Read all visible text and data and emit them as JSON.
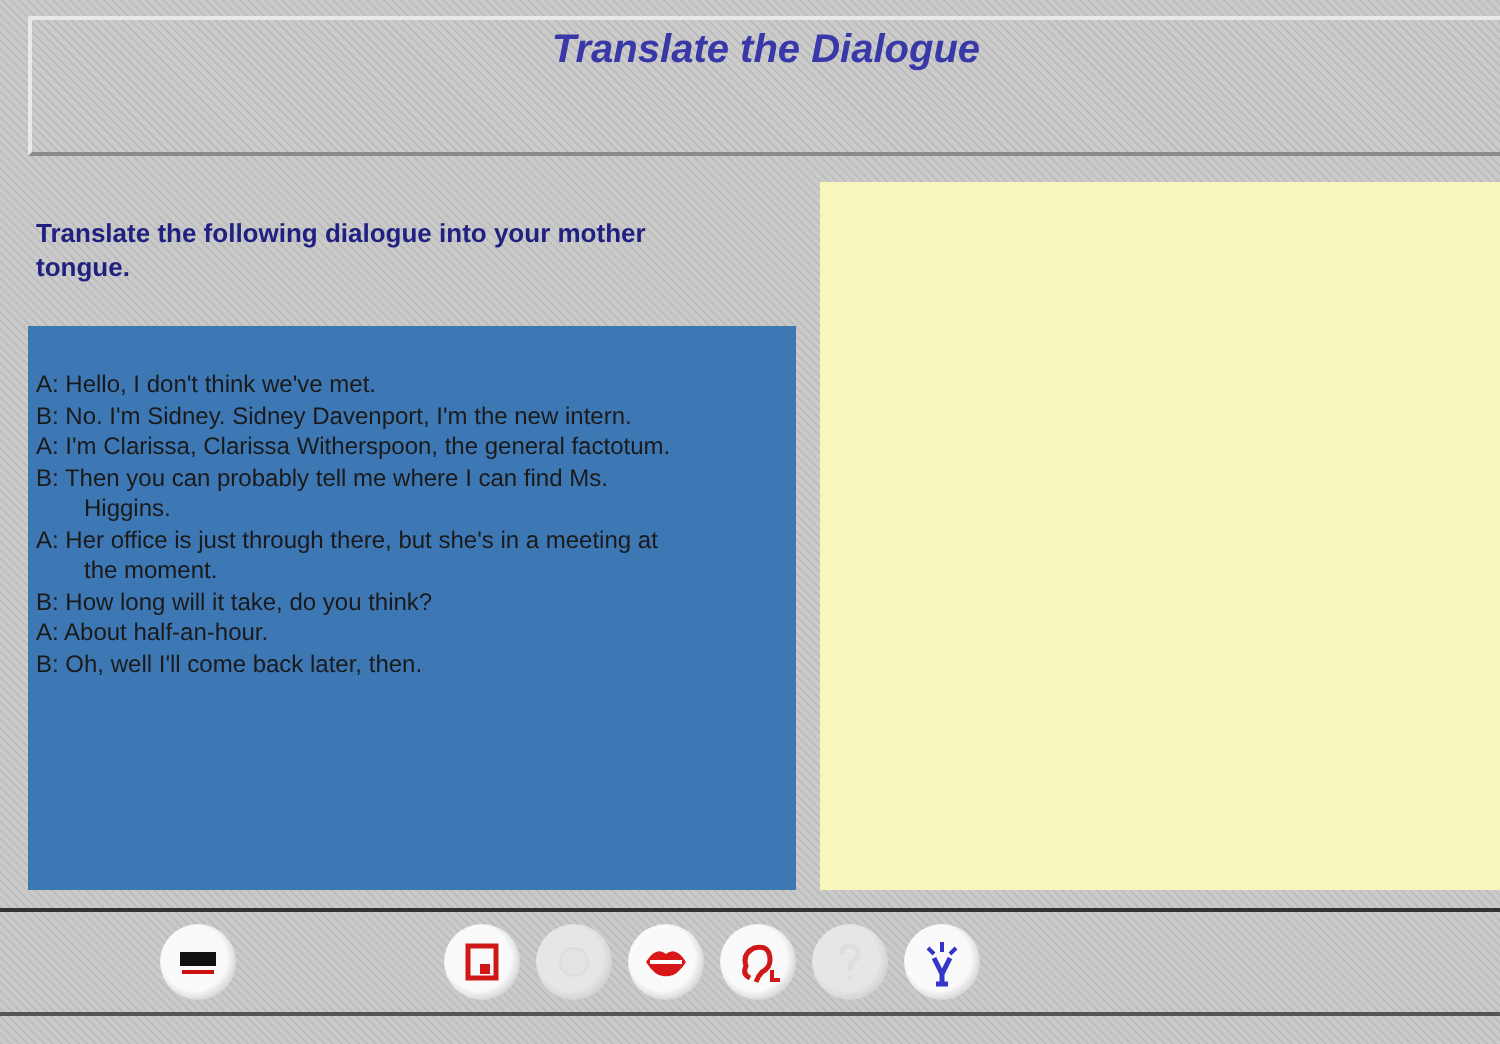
{
  "header": {
    "title": "Translate the Dialogue"
  },
  "instructions": "Translate the following dialogue into your mother tongue.",
  "dialogue": [
    "A: Hello, I don't think we've met.",
    "B: No. I'm Sidney. Sidney Davenport, I'm the new intern.",
    "A: I'm Clarissa, Clarissa Witherspoon, the general factotum.",
    "B: Then you can probably tell me where I can find Ms. Higgins.",
    "A: Her office is just through there, but she's in a meeting at the moment.",
    "B: How long will it take, do you think?",
    "A: About half-an-hour.",
    "B: Oh, well I'll come back later, then."
  ],
  "toolbar": [
    {
      "kind": "logo",
      "disabled": false
    },
    {
      "kind": "save",
      "disabled": false
    },
    {
      "kind": "record",
      "disabled": true
    },
    {
      "kind": "speak",
      "disabled": false
    },
    {
      "kind": "listen",
      "disabled": false
    },
    {
      "kind": "help",
      "disabled": true
    },
    {
      "kind": "hint",
      "disabled": false
    }
  ]
}
